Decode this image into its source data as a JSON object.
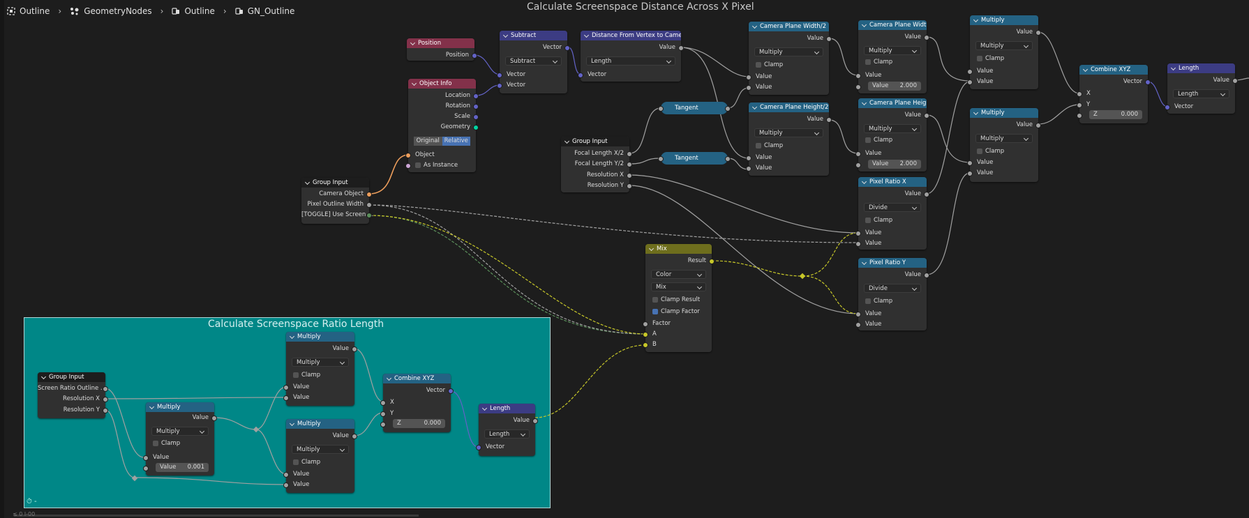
{
  "breadcrumb": {
    "items": [
      "Outline",
      "GeometryNodes",
      "Outline",
      "GN_Outline"
    ]
  },
  "frames": {
    "main_title": "Calculate Screenspace Distance Across X Pixel",
    "inner_title": "Calculate Screenspace Ratio Length",
    "inner_bottom_label": "-"
  },
  "nodes": {
    "position": {
      "title": "Position",
      "out": "Position"
    },
    "object_info": {
      "title": "Object Info",
      "outs": [
        "Location",
        "Rotation",
        "Scale",
        "Geometry"
      ],
      "seg": [
        "Original",
        "Relative"
      ],
      "in_object": "Object",
      "in_instance": "As Instance"
    },
    "subtract": {
      "title": "Subtract",
      "out": "Vector",
      "op": "Subtract",
      "in1": "Vector",
      "in2": "Vector"
    },
    "distance": {
      "title": "Distance From Vertex to Camera",
      "out": "Value",
      "op": "Length",
      "in1": "Vector"
    },
    "group_input_main": {
      "title": "Group Input",
      "outs": [
        "Camera Object",
        "Pixel Outline Width",
        "[TOGGLE] Use Screen ..."
      ]
    },
    "group_input_focal": {
      "title": "Group Input",
      "outs": [
        "Focal Length X/2",
        "Focal Length Y/2",
        "Resolution X",
        "Resolution Y"
      ]
    },
    "tangent1": {
      "title": "Tangent"
    },
    "tangent2": {
      "title": "Tangent"
    },
    "cam_width_half": {
      "title": "Camera Plane Width/2",
      "out": "Value",
      "op": "Multiply",
      "clamp": "Clamp",
      "in1": "Value",
      "in2": "Value"
    },
    "cam_height_half": {
      "title": "Camera Plane Height/2",
      "out": "Value",
      "op": "Multiply",
      "clamp": "Clamp",
      "in1": "Value",
      "in2": "Value"
    },
    "cam_width": {
      "title": "Camera Plane Width",
      "out": "Value",
      "op": "Multiply",
      "clamp": "Clamp",
      "in1": "Value",
      "num_label": "Value",
      "num_value": "2.000"
    },
    "cam_height": {
      "title": "Camera Plane Height",
      "out": "Value",
      "op": "Multiply",
      "clamp": "Clamp",
      "in1": "Value",
      "num_label": "Value",
      "num_value": "2.000"
    },
    "pixel_ratio_x": {
      "title": "Pixel Ratio X",
      "out": "Value",
      "op": "Divide",
      "clamp": "Clamp",
      "in1": "Value",
      "in2": "Value"
    },
    "pixel_ratio_y": {
      "title": "Pixel Ratio Y",
      "out": "Value",
      "op": "Divide",
      "clamp": "Clamp",
      "in1": "Value",
      "in2": "Value"
    },
    "multiply_a": {
      "title": "Multiply",
      "out": "Value",
      "op": "Multiply",
      "clamp": "Clamp",
      "in1": "Value",
      "in2": "Value"
    },
    "multiply_b": {
      "title": "Multiply",
      "out": "Value",
      "op": "Multiply",
      "clamp": "Clamp",
      "in1": "Value",
      "in2": "Value"
    },
    "combine_main": {
      "title": "Combine XYZ",
      "out": "Vector",
      "x": "X",
      "y": "Y",
      "z_label": "Z",
      "z_value": "0.000"
    },
    "length_main": {
      "title": "Length",
      "out": "Value",
      "op": "Length",
      "in1": "Vector"
    },
    "mix": {
      "title": "Mix",
      "out": "Result",
      "type": "Color",
      "blend": "Mix",
      "clamp_result": "Clamp Result",
      "clamp_factor": "Clamp Factor",
      "factor": "Factor",
      "a": "A",
      "b": "B"
    },
    "group_input_frame": {
      "title": "Group Input",
      "outs": [
        "Screen Ratio Outline ...",
        "Resolution X",
        "Resolution Y"
      ]
    },
    "multiply_f1": {
      "title": "Multiply",
      "out": "Value",
      "op": "Multiply",
      "clamp": "Clamp",
      "in1": "Value",
      "num_label": "Value",
      "num_value": "0.001"
    },
    "multiply_f2": {
      "title": "Multiply",
      "out": "Value",
      "op": "Multiply",
      "clamp": "Clamp",
      "in1": "Value",
      "in2": "Value"
    },
    "multiply_f3": {
      "title": "Multiply",
      "out": "Value",
      "op": "Multiply",
      "clamp": "Clamp",
      "in1": "Value",
      "in2": "Value"
    },
    "combine_frame": {
      "title": "Combine XYZ",
      "out": "Vector",
      "x": "X",
      "y": "Y",
      "z_label": "Z",
      "z_value": "0.000"
    },
    "length_frame": {
      "title": "Length",
      "out": "Value",
      "op": "Length",
      "in1": "Vector"
    }
  },
  "colors": {
    "background": "#1d1d1d",
    "frame": "#008787",
    "node_body": "#303030",
    "header_math": "#246283",
    "header_input": "#83314a",
    "header_vector": "#3c3c83",
    "header_mix": "#6e6e1d",
    "wire_float": "#a1a1a1",
    "wire_vector": "#6363c7",
    "wire_object": "#ed9e5c",
    "wire_color": "#c7c729",
    "wire_bool": "#5b8f5b"
  },
  "status": {
    "bottom_left": "≤ 0 l-00"
  }
}
